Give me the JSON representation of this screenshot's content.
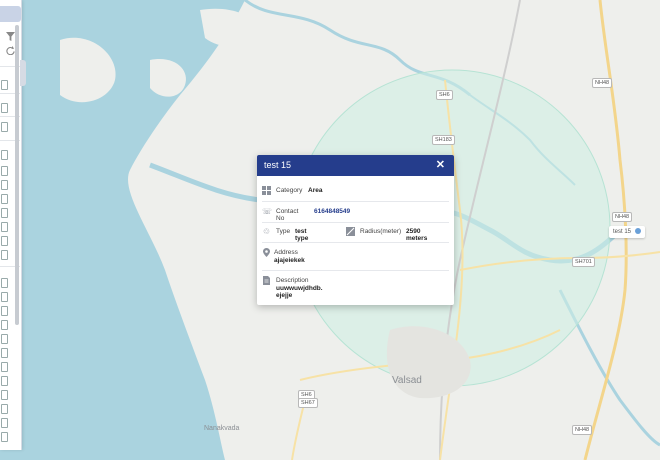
{
  "popup": {
    "title": "test 15",
    "close_icon": "close-icon",
    "category_label": "Category",
    "category_value": "Area",
    "contact_label": "Contact No",
    "contact_value": "6164848549",
    "type_label": "Type",
    "type_value": "test type",
    "radius_label": "Radius(meter)",
    "radius_value": "2590 meters",
    "address_label": "Address",
    "address_value": "ajajeiekek",
    "description_label": "Description",
    "description_value": "uuwwuwjdhdb. ejejje"
  },
  "map": {
    "marker_label": "test 15",
    "city_label": "Valsad",
    "village_label": "Nanakvada",
    "road_labels": [
      "NH48",
      "SH6",
      "SH183",
      "SH701",
      "NH48",
      "SH6",
      "SH67",
      "NH48"
    ],
    "geofence_color": "#bfe8dc",
    "accent_color": "#253d8c"
  },
  "sidebar": {
    "filter_icon": "filter-icon",
    "refresh_icon": "refresh-icon",
    "row_icon": "phone-icon"
  }
}
